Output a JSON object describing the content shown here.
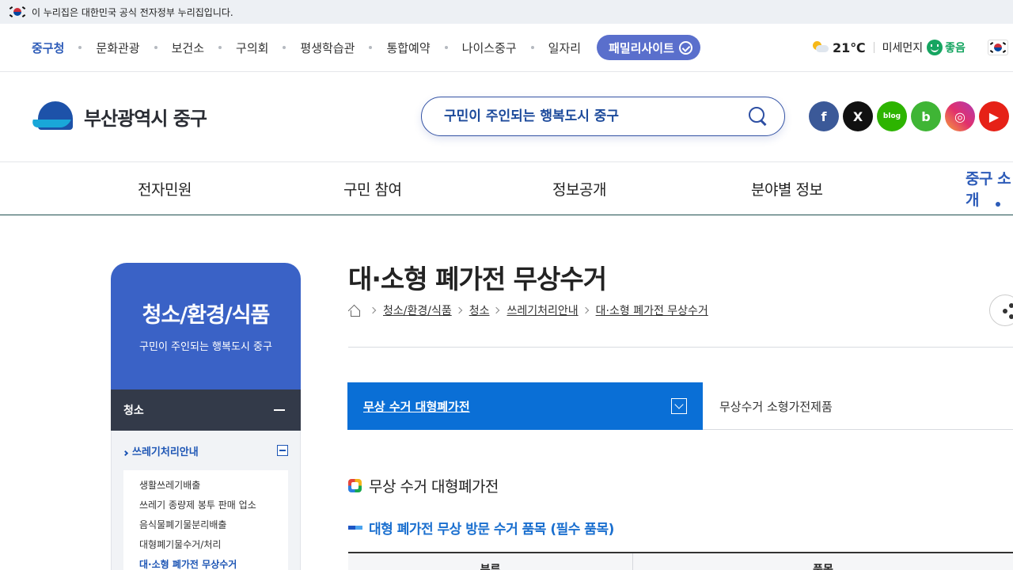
{
  "gov_banner": {
    "text": "이 누리집은 대한민국 공식 전자정부 누리집입니다."
  },
  "top_links": [
    {
      "label": "중구청"
    },
    {
      "label": "문화관광"
    },
    {
      "label": "보건소"
    },
    {
      "label": "구의회"
    },
    {
      "label": "평생학습관"
    },
    {
      "label": "통합예약"
    },
    {
      "label": "나이스중구"
    },
    {
      "label": "일자리"
    }
  ],
  "family_site": {
    "label": "패밀리사이트"
  },
  "weather": {
    "temp": "21℃",
    "dust_label": "미세먼지",
    "dust_status": "좋음"
  },
  "logo": {
    "text": "부산광역시 중구"
  },
  "search": {
    "placeholder": "구민이 주인되는 행복도시 중구",
    "value": ""
  },
  "social": {
    "fb": "f",
    "x": "X",
    "blog": "blog",
    "band": "b",
    "insta": "◎",
    "yt": "▶"
  },
  "gnb": [
    {
      "label": "전자민원"
    },
    {
      "label": "구민 참여"
    },
    {
      "label": "정보공개"
    },
    {
      "label": "분야별 정보"
    },
    {
      "label": "중구 소개"
    }
  ],
  "sidebar": {
    "title": "청소/환경/식품",
    "subtitle": "구민이 주인되는 행복도시 중구",
    "category": "청소",
    "sub_menu": "쓰레기처리안내",
    "items": [
      {
        "label": "생활쓰레기배출"
      },
      {
        "label": "쓰레기 종량제 봉투 판매 업소"
      },
      {
        "label": "음식물폐기물분리배출"
      },
      {
        "label": "대형폐기물수거/처리"
      },
      {
        "label": "대·소형 폐가전 무상수거"
      }
    ]
  },
  "page": {
    "title": "대·소형 폐가전 무상수거",
    "breadcrumb": [
      "청소/환경/식품",
      "청소",
      "쓰레기처리안내",
      "대·소형 폐가전 무상수거"
    ]
  },
  "tabs": [
    {
      "label": "무상 수거 대형폐가전"
    },
    {
      "label": "무상수거 소형가전제품"
    }
  ],
  "section": {
    "h3": "무상 수거 대형폐가전",
    "h4": "대형 폐가전 무상 방문 수거 품목 (필수 품목)",
    "table_headers": [
      "분류",
      "품목"
    ]
  },
  "colors": {
    "primary": "#3a62c6",
    "tab_active": "#0a6fd6",
    "sidebar_dark": "#333a49",
    "good": "#16a561"
  }
}
